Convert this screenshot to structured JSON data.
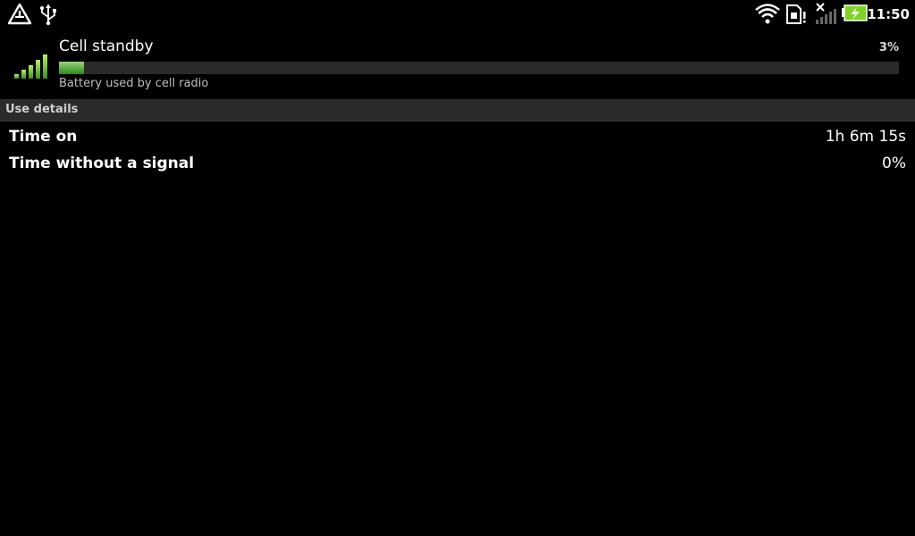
{
  "status_bar": {
    "time": "11:50",
    "icons": [
      "warning-icon",
      "usb-icon",
      "wifi-icon",
      "sim-card-alert-icon",
      "signal-no-service-icon",
      "battery-charging-icon"
    ],
    "battery_color": "#7ed321"
  },
  "header": {
    "title": "Cell standby",
    "percent": "3%",
    "progress_fraction": 0.03,
    "subtitle": "Battery used by cell radio",
    "icon": "cell-signal-icon"
  },
  "section": {
    "title": "Use details"
  },
  "details": [
    {
      "label": "Time on",
      "value": "1h 6m 15s"
    },
    {
      "label": "Time without a signal",
      "value": "0%"
    }
  ]
}
